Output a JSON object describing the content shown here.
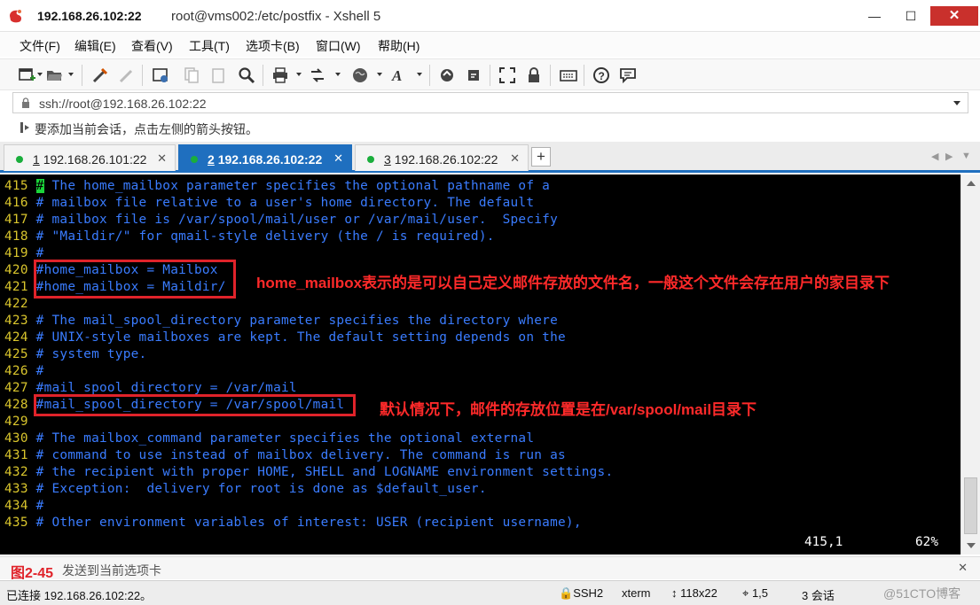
{
  "window": {
    "title_ip": "192.168.26.102:22",
    "title_rest": "root@vms002:/etc/postfix - Xshell 5",
    "minimize": "—",
    "maximize": "☐",
    "close": "✕"
  },
  "menu": [
    "文件(F)",
    "编辑(E)",
    "查看(V)",
    "工具(T)",
    "选项卡(B)",
    "窗口(W)",
    "帮助(H)"
  ],
  "address": {
    "value": "ssh://root@192.168.26.102:22"
  },
  "hint": {
    "text": "要添加当前会话，点击左侧的箭头按钮。"
  },
  "tabs": [
    {
      "num": "1",
      "host": "192.168.26.101:22",
      "active": false
    },
    {
      "num": "2",
      "host": "192.168.26.102:22",
      "active": true
    },
    {
      "num": "3",
      "host": "192.168.26.102:22",
      "active": false
    }
  ],
  "tab_add": "+",
  "terminal": {
    "lines": [
      {
        "n": "415",
        "text": " The home_mailbox parameter specifies the optional pathname of a",
        "cursor": "#"
      },
      {
        "n": "416",
        "text": "# mailbox file relative to a user's home directory. The default"
      },
      {
        "n": "417",
        "text": "# mailbox file is /var/spool/mail/user or /var/mail/user.  Specify"
      },
      {
        "n": "418",
        "text": "# \"Maildir/\" for qmail-style delivery (the / is required)."
      },
      {
        "n": "419",
        "text": "#"
      },
      {
        "n": "420",
        "text": "#home_mailbox = Mailbox"
      },
      {
        "n": "421",
        "text": "#home_mailbox = Maildir/"
      },
      {
        "n": "422",
        "text": ""
      },
      {
        "n": "423",
        "text": "# The mail_spool_directory parameter specifies the directory where"
      },
      {
        "n": "424",
        "text": "# UNIX-style mailboxes are kept. The default setting depends on the"
      },
      {
        "n": "425",
        "text": "# system type."
      },
      {
        "n": "426",
        "text": "#"
      },
      {
        "n": "427",
        "text": "#mail_spool_directory = /var/mail"
      },
      {
        "n": "428",
        "text": "#mail_spool_directory = /var/spool/mail"
      },
      {
        "n": "429",
        "text": ""
      },
      {
        "n": "430",
        "text": "# The mailbox_command parameter specifies the optional external"
      },
      {
        "n": "431",
        "text": "# command to use instead of mailbox delivery. The command is run as"
      },
      {
        "n": "432",
        "text": "# the recipient with proper HOME, SHELL and LOGNAME environment settings."
      },
      {
        "n": "433",
        "text": "# Exception:  delivery for root is done as $default_user."
      },
      {
        "n": "434",
        "text": "#"
      },
      {
        "n": "435",
        "text": "# Other environment variables of interest: USER (recipient username),"
      }
    ],
    "position": "415,1",
    "percent": "62%"
  },
  "annotations": {
    "home_mailbox": "home_mailbox表示的是可以自己定义邮件存放的文件名，一般这个文件会存在用户的家目录下",
    "mail_spool": "默认情况下，邮件的存放位置是在/var/spool/mail目录下",
    "figure": "图2-45"
  },
  "sendbar": {
    "text": "发送到当前选项卡"
  },
  "status": {
    "connected": "已连接 192.168.26.102:22。",
    "protocol": "SSH2",
    "term": "xterm",
    "size": "118x22",
    "cursor": "1,5",
    "sessions": "3 会话",
    "watermark": "@51CTO博客"
  },
  "colors": {
    "accent": "#1f6fbf",
    "annotation": "#ff2a2a",
    "terminal_bg": "#000000",
    "line_number": "#d9c52d",
    "comment": "#3a7cff",
    "cursor": "#1bd43a"
  }
}
